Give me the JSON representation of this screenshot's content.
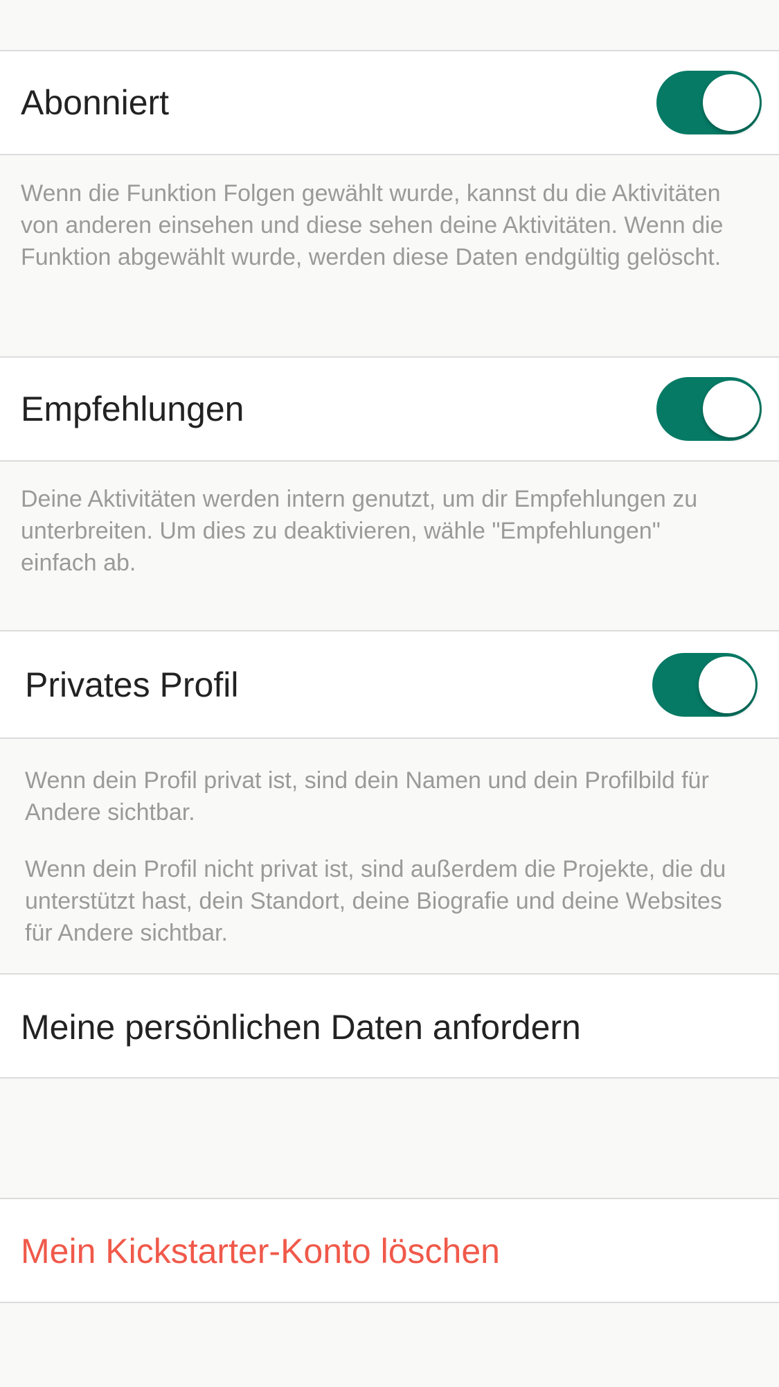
{
  "accent_color": "#067a65",
  "danger_color": "#f0594a",
  "settings": {
    "followed": {
      "label": "Abonniert",
      "toggle_on": true,
      "description": "Wenn die Funktion Folgen gewählt wurde, kannst du die Aktivitäten von anderen einsehen und diese sehen deine Aktivitäten. Wenn die Funktion abgewählt wurde, werden diese Daten endgültig gelöscht."
    },
    "recommendations": {
      "label": "Empfehlungen",
      "toggle_on": true,
      "description": "Deine Aktivitäten werden intern genutzt, um dir Empfehlungen zu unterbreiten. Um dies zu deaktivieren, wähle \"Empfehlungen\" einfach ab."
    },
    "private_profile": {
      "label": "Privates Profil",
      "toggle_on": true,
      "description_1": "Wenn dein Profil privat ist, sind dein Namen und dein Profilbild für Andere sichtbar.",
      "description_2": "Wenn dein Profil nicht privat ist, sind außerdem die Projekte, die du unterstützt hast, dein Standort, deine Biografie und deine Websites für Andere sichtbar."
    }
  },
  "actions": {
    "request_data_label": "Meine persönlichen Daten anfordern",
    "delete_account_label": "Mein Kickstarter-Konto löschen"
  }
}
